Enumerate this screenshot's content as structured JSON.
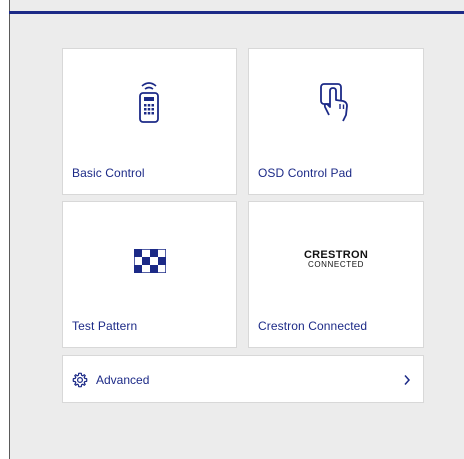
{
  "colors": {
    "accent": "#1c2a87",
    "tile_background": "#ffffff",
    "panel_background": "#ececec",
    "border": "#d8d8d8"
  },
  "tiles": [
    {
      "label": "Basic Control",
      "icon": "remote-control-icon"
    },
    {
      "label": "OSD Control Pad",
      "icon": "touch-hand-icon"
    },
    {
      "label": "Test Pattern",
      "icon": "checkerboard-icon"
    },
    {
      "label": "Crestron Connected",
      "icon": "crestron-connected-logo",
      "logo_text": [
        "CRESTRON",
        "CONNECTED"
      ]
    }
  ],
  "advanced": {
    "label": "Advanced",
    "icon": "gear-icon",
    "chevron": "chevron-right-icon"
  }
}
